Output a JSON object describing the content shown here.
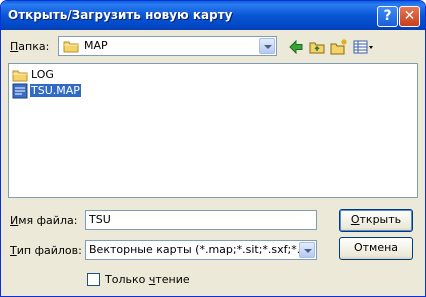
{
  "window": {
    "title": "Открыть/Загрузить новую карту",
    "help_glyph": "?",
    "close_glyph": "✕"
  },
  "folder": {
    "label_accel": "П",
    "label_rest": "апка:",
    "value": "MAP",
    "icon": "folder-icon"
  },
  "toolbar": {
    "icons": [
      "back-arrow-icon",
      "up-folder-icon",
      "new-folder-icon",
      "view-menu-icon"
    ]
  },
  "files": [
    {
      "name": "LOG",
      "icon": "folder-icon",
      "selected": false
    },
    {
      "name": "TSU.MAP",
      "icon": "map-file-icon",
      "selected": true
    }
  ],
  "filename": {
    "label_accel": "И",
    "label_rest": "мя файла:",
    "value": "TSU"
  },
  "filetype": {
    "label_accel": "Т",
    "label_rest": "ип файлов:",
    "value": "Векторные карты (*.map;*.sit;*.sxf;*.txf;*.txt"
  },
  "buttons": {
    "open_accel": "О",
    "open_rest": "ткрыть",
    "cancel": "Отмена"
  },
  "readonly": {
    "label_prefix": "Только ",
    "label_accel": "ч",
    "label_rest": "тение",
    "checked": false
  },
  "colors": {
    "titlebar": "#0a56d4",
    "selection": "#316ac5",
    "window_bg": "#ece9d8"
  }
}
